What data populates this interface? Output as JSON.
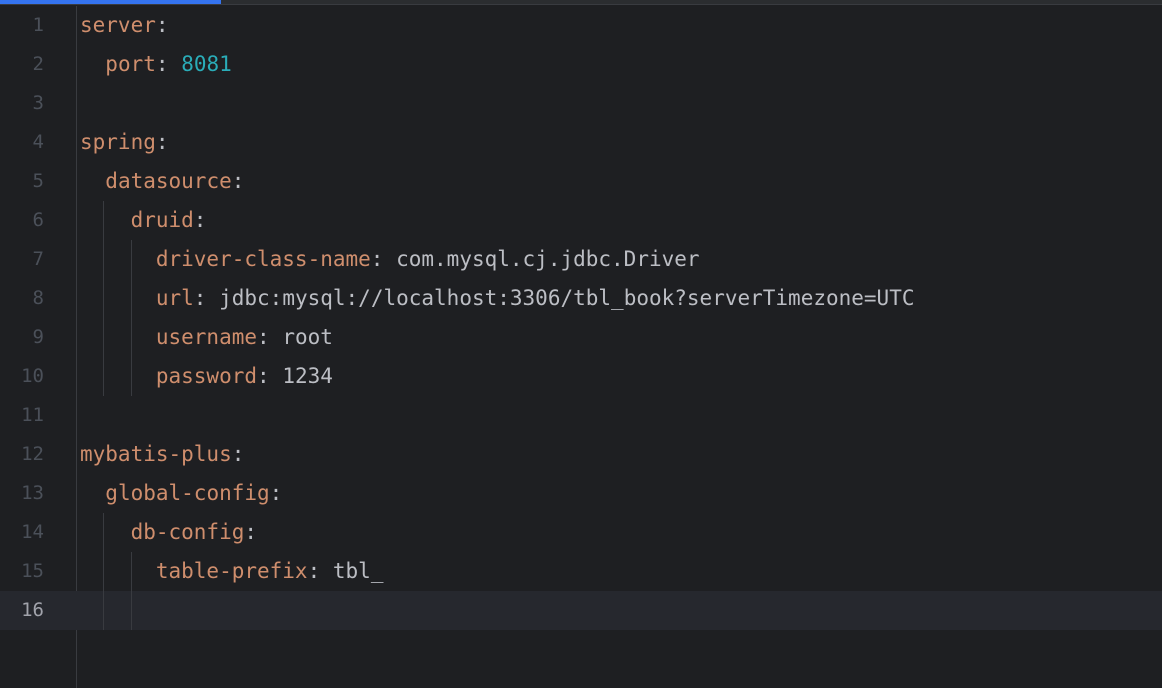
{
  "editor": {
    "progress": 0.19,
    "current_line": 16,
    "lines": [
      {
        "n": "1",
        "indent": 0,
        "key": "server",
        "colon": ":",
        "value": "",
        "value_type": "none"
      },
      {
        "n": "2",
        "indent": 1,
        "key": "port",
        "colon": ":",
        "value": "8081",
        "value_type": "number"
      },
      {
        "n": "3",
        "indent": 0,
        "key": "",
        "colon": "",
        "value": "",
        "value_type": "none"
      },
      {
        "n": "4",
        "indent": 0,
        "key": "spring",
        "colon": ":",
        "value": "",
        "value_type": "none"
      },
      {
        "n": "5",
        "indent": 1,
        "key": "datasource",
        "colon": ":",
        "value": "",
        "value_type": "none"
      },
      {
        "n": "6",
        "indent": 2,
        "key": "druid",
        "colon": ":",
        "value": "",
        "value_type": "none"
      },
      {
        "n": "7",
        "indent": 3,
        "key": "driver-class-name",
        "colon": ":",
        "value": "com.mysql.cj.jdbc.Driver",
        "value_type": "string"
      },
      {
        "n": "8",
        "indent": 3,
        "key": "url",
        "colon": ":",
        "value": "jdbc:mysql://localhost:3306/tbl_book?serverTimezone=UTC",
        "value_type": "string"
      },
      {
        "n": "9",
        "indent": 3,
        "key": "username",
        "colon": ":",
        "value": "root",
        "value_type": "string"
      },
      {
        "n": "10",
        "indent": 3,
        "key": "password",
        "colon": ":",
        "value": "1234",
        "value_type": "string"
      },
      {
        "n": "11",
        "indent": 0,
        "key": "",
        "colon": "",
        "value": "",
        "value_type": "none"
      },
      {
        "n": "12",
        "indent": 0,
        "key": "mybatis-plus",
        "colon": ":",
        "value": "",
        "value_type": "none"
      },
      {
        "n": "13",
        "indent": 1,
        "key": "global-config",
        "colon": ":",
        "value": "",
        "value_type": "none"
      },
      {
        "n": "14",
        "indent": 2,
        "key": "db-config",
        "colon": ":",
        "value": "",
        "value_type": "none"
      },
      {
        "n": "15",
        "indent": 3,
        "key": "table-prefix",
        "colon": ":",
        "value": "tbl_",
        "value_type": "string"
      },
      {
        "n": "16",
        "indent": 0,
        "key": "",
        "colon": "",
        "value": "",
        "value_type": "none"
      }
    ]
  },
  "colors": {
    "background": "#1e1f22",
    "key": "#cf8e6d",
    "number": "#2aacb8",
    "text": "#bcbec4",
    "line_number": "#4b5059",
    "current_line": "#26282e",
    "progress": "#3574f0"
  }
}
